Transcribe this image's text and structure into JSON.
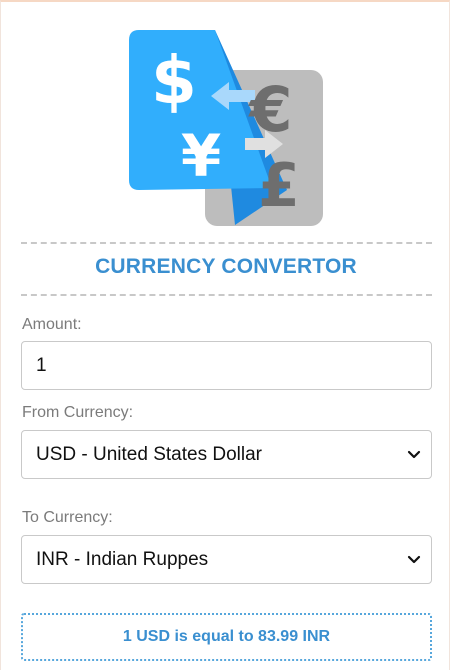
{
  "header": {
    "title": "CURRENCY CONVERTOR"
  },
  "amount": {
    "label": "Amount:",
    "value": "1"
  },
  "from": {
    "label": "From Currency:",
    "selected": "USD - United States Dollar"
  },
  "to": {
    "label": "To Currency:",
    "selected": "INR - Indian Ruppes"
  },
  "result": {
    "text": "1 USD is equal to 83.99 INR"
  },
  "logo": {
    "icon": "currency-exchange-icon",
    "glyphs": [
      "$",
      "¥",
      "€",
      "£"
    ]
  },
  "colors": {
    "accent": "#3a8fd0",
    "logo_blue": "#31aefc",
    "logo_gray": "#bdbdbd"
  }
}
